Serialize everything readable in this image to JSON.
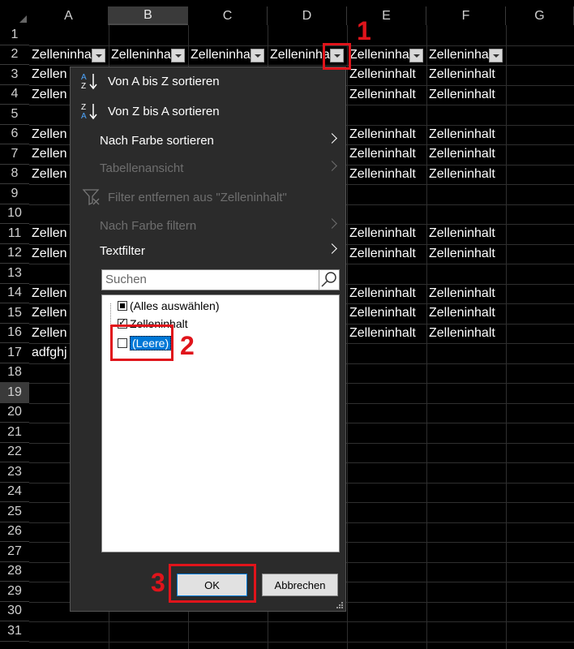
{
  "columns": [
    "A",
    "B",
    "C",
    "D",
    "E",
    "F",
    "G"
  ],
  "selected_column": "B",
  "rows": [
    "1",
    "2",
    "3",
    "4",
    "5",
    "6",
    "7",
    "8",
    "9",
    "10",
    "11",
    "12",
    "13",
    "14",
    "15",
    "16",
    "17",
    "18",
    "19",
    "20",
    "21",
    "22",
    "23",
    "24",
    "25",
    "26",
    "27",
    "28",
    "29",
    "30",
    "31"
  ],
  "selected_row": "19",
  "headers": [
    "Zelleninhalt",
    "Zelleninhalt",
    "Zelleninhalt",
    "Zelleninhalt",
    "Zelleninhalt",
    "Zelleninhalt"
  ],
  "cell_text_full": "Zelleninhalt",
  "cell_text_clipped_a": "Zellen",
  "row17_a": "adfghj",
  "data_rows": [
    "3",
    "4",
    "6",
    "7",
    "8",
    "11",
    "12",
    "14",
    "15",
    "16"
  ],
  "menu": {
    "sort_az": "Von A bis Z sortieren",
    "sort_za": "Von Z bis A sortieren",
    "sort_color": "Nach Farbe sortieren",
    "table_view": "Tabellenansicht",
    "clear_filter": "Filter entfernen aus \"Zelleninhalt\"",
    "filter_color": "Nach Farbe filtern",
    "text_filter": "Textfilter",
    "search_placeholder": "Suchen",
    "items": [
      "(Alles auswählen)",
      "Zelleninhalt",
      "(Leere)"
    ],
    "ok": "OK",
    "cancel": "Abbrechen"
  },
  "annotations": [
    "1",
    "2",
    "3"
  ],
  "colors": {
    "annotation": "#e0141b",
    "selection": "#0078d7",
    "menu_bg": "#2b2b2b"
  }
}
